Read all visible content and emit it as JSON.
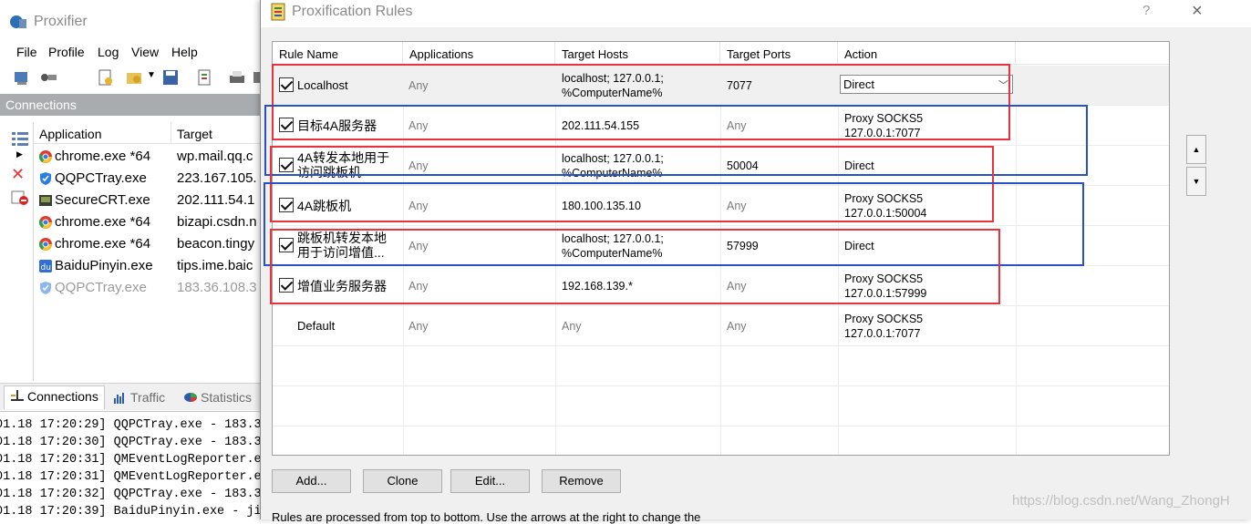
{
  "main_window": {
    "title": "Proxifier",
    "menu": [
      "File",
      "Profile",
      "Log",
      "View",
      "Help"
    ],
    "connections_header": "Connections",
    "columns": [
      "Application",
      "Target"
    ],
    "rows": [
      {
        "app": "chrome.exe *64",
        "target": "wp.mail.qq.c",
        "icon": "chrome-icon",
        "faded": false
      },
      {
        "app": "QQPCTray.exe",
        "target": "223.167.105.",
        "icon": "shield-icon",
        "faded": false
      },
      {
        "app": "SecureCRT.exe",
        "target": "202.111.54.1",
        "icon": "terminal-icon",
        "faded": false
      },
      {
        "app": "chrome.exe *64",
        "target": "bizapi.csdn.n",
        "icon": "chrome-icon",
        "faded": false
      },
      {
        "app": "chrome.exe *64",
        "target": "beacon.tingy",
        "icon": "chrome-icon",
        "faded": false
      },
      {
        "app": "BaiduPinyin.exe",
        "target": "tips.ime.baic",
        "icon": "baidu-icon",
        "faded": false
      },
      {
        "app": "QQPCTray.exe",
        "target": "183.36.108.3",
        "icon": "shield-icon",
        "faded": true
      }
    ],
    "tabs": [
      "Connections",
      "Traffic",
      "Statistics"
    ],
    "log": [
      "01.18 17:20:29] QQPCTray.exe - 183.3",
      "01.18 17:20:30] QQPCTray.exe - 183.3",
      "01.18 17:20:31] QMEventLogReporter.e",
      "01.18 17:20:31] QMEventLogReporter.e",
      "01.18 17:20:32] QQPCTray.exe - 183.3",
      "01.18 17:20:39] BaiduPinyin.exe - ji"
    ]
  },
  "dialog": {
    "title": "Proxification Rules",
    "help": "?",
    "close": "×",
    "columns": [
      "Rule Name",
      "Applications",
      "Target Hosts",
      "Target Ports",
      "Action"
    ],
    "rules": [
      {
        "checked": true,
        "name": [
          "Localhost"
        ],
        "apps": "Any",
        "hosts": [
          "localhost; 127.0.0.1;",
          "%ComputerName%"
        ],
        "ports": "7077",
        "action": [
          "Direct"
        ],
        "selected": true,
        "cjk": false
      },
      {
        "checked": true,
        "name": [
          "目标4A服务器"
        ],
        "apps": "Any",
        "hosts": [
          "202.111.54.155"
        ],
        "ports": "Any",
        "action": [
          "Proxy SOCKS5",
          "127.0.0.1:7077"
        ],
        "selected": false,
        "cjk": true
      },
      {
        "checked": true,
        "name": [
          "4A转发本地用于",
          "访问跳板机"
        ],
        "apps": "Any",
        "hosts": [
          "localhost; 127.0.0.1;",
          "%ComputerName%"
        ],
        "ports": "50004",
        "action": [
          "Direct"
        ],
        "selected": false,
        "cjk": true
      },
      {
        "checked": true,
        "name": [
          "4A跳板机"
        ],
        "apps": "Any",
        "hosts": [
          "180.100.135.10"
        ],
        "ports": "Any",
        "action": [
          "Proxy SOCKS5",
          "127.0.0.1:50004"
        ],
        "selected": false,
        "cjk": true
      },
      {
        "checked": true,
        "name": [
          "跳板机转发本地",
          "用于访问增值..."
        ],
        "apps": "Any",
        "hosts": [
          "localhost; 127.0.0.1;",
          "%ComputerName%"
        ],
        "ports": "57999",
        "action": [
          "Direct"
        ],
        "selected": false,
        "cjk": true
      },
      {
        "checked": true,
        "name": [
          "增值业务服务器"
        ],
        "apps": "Any",
        "hosts": [
          "192.168.139.*"
        ],
        "ports": "Any",
        "action": [
          "Proxy SOCKS5",
          "127.0.0.1:57999"
        ],
        "selected": false,
        "cjk": true
      },
      {
        "checked": false,
        "name": [
          "Default"
        ],
        "apps": "Any",
        "hosts": [
          "Any"
        ],
        "ports": "Any",
        "action": [
          "Proxy SOCKS5",
          "127.0.0.1:7077"
        ],
        "selected": false,
        "cjk": false
      }
    ],
    "buttons": {
      "add": "Add...",
      "clone": "Clone",
      "edit": "Edit...",
      "remove": "Remove"
    },
    "move_up": "▲",
    "move_down": "▼",
    "footnote": "Rules are processed from top to bottom. Use the arrows at the right to change the"
  },
  "watermark": "https://blog.csdn.net/Wang_ZhongH",
  "colors": {
    "annotation_red": "#e8323c",
    "annotation_blue": "#2850c8",
    "header_bar": "#a9acaf"
  }
}
